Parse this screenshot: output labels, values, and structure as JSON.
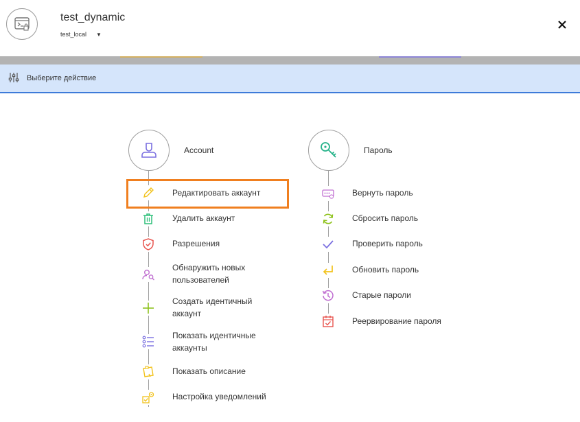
{
  "header": {
    "title": "test_dynamic",
    "connection": "test_local"
  },
  "action_bar": {
    "label": "Выберите действие"
  },
  "groups": {
    "account": {
      "title": "Account",
      "items": [
        {
          "label": "Редактировать аккаунт",
          "icon": "pencil-icon"
        },
        {
          "label": "Удалить аккаунт",
          "icon": "trash-icon"
        },
        {
          "label": "Разрешения",
          "icon": "shield-icon"
        },
        {
          "label": "Обнаружить новых пользователей",
          "icon": "user-search-icon"
        },
        {
          "label": "Создать идентичный аккаунт",
          "icon": "plus-icon"
        },
        {
          "label": "Показать идентичные аккаунты",
          "icon": "list-icon"
        },
        {
          "label": "Показать описание",
          "icon": "note-icon"
        },
        {
          "label": "Настройка уведомлений",
          "icon": "notification-settings-icon"
        }
      ]
    },
    "password": {
      "title": "Пароль",
      "items": [
        {
          "label": "Вернуть пароль",
          "icon": "password-field-icon"
        },
        {
          "label": "Сбросить пароль",
          "icon": "refresh-icon"
        },
        {
          "label": "Проверить пароль",
          "icon": "check-icon"
        },
        {
          "label": "Обновить пароль",
          "icon": "return-arrow-icon"
        },
        {
          "label": "Старые пароли",
          "icon": "history-icon"
        },
        {
          "label": "Реервирование пароля",
          "icon": "calendar-check-icon"
        }
      ]
    }
  },
  "colors": {
    "accent": "#3d7bd9",
    "action_bar_bg": "#d5e5fb",
    "highlight": "#f07f1f"
  }
}
